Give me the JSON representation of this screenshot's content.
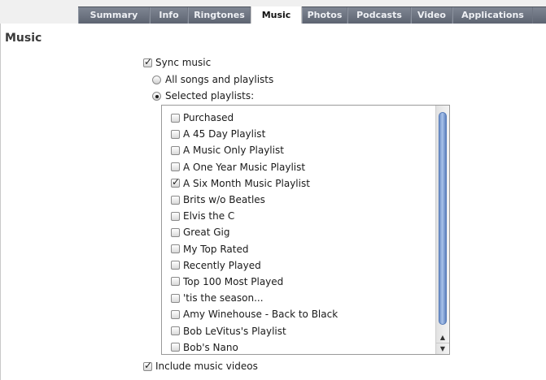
{
  "tabs": [
    {
      "label": "Summary",
      "active": false
    },
    {
      "label": "Info",
      "active": false
    },
    {
      "label": "Ringtones",
      "active": false
    },
    {
      "label": "Music",
      "active": true
    },
    {
      "label": "Photos",
      "active": false
    },
    {
      "label": "Podcasts",
      "active": false
    },
    {
      "label": "Video",
      "active": false
    },
    {
      "label": "Applications",
      "active": false
    }
  ],
  "section_title": "Music",
  "sync_music": {
    "label": "Sync music",
    "checked": true
  },
  "sync_options": [
    {
      "label": "All songs and playlists",
      "selected": false
    },
    {
      "label": "Selected playlists:",
      "selected": true
    }
  ],
  "playlists": [
    {
      "label": "Purchased",
      "checked": false
    },
    {
      "label": "A 45 Day Playlist",
      "checked": false
    },
    {
      "label": "A Music Only Playlist",
      "checked": false
    },
    {
      "label": "A One Year Music Playlist",
      "checked": false
    },
    {
      "label": "A Six Month Music Playlist",
      "checked": true
    },
    {
      "label": "Brits w/o Beatles",
      "checked": false
    },
    {
      "label": "Elvis the C",
      "checked": false
    },
    {
      "label": "Great Gig",
      "checked": false
    },
    {
      "label": "My Top Rated",
      "checked": false
    },
    {
      "label": "Recently Played",
      "checked": false
    },
    {
      "label": "Top 100 Most Played",
      "checked": false
    },
    {
      "label": "'tis the season...",
      "checked": false
    },
    {
      "label": "Amy Winehouse - Back to Black",
      "checked": false
    },
    {
      "label": "Bob LeVitus's Playlist",
      "checked": false
    },
    {
      "label": "Bob's Nano",
      "checked": false
    }
  ],
  "include_videos": {
    "label": "Include music videos",
    "checked": true
  },
  "icons": {
    "scroll_up": "arrow-up-icon",
    "scroll_down": "arrow-down-icon"
  }
}
